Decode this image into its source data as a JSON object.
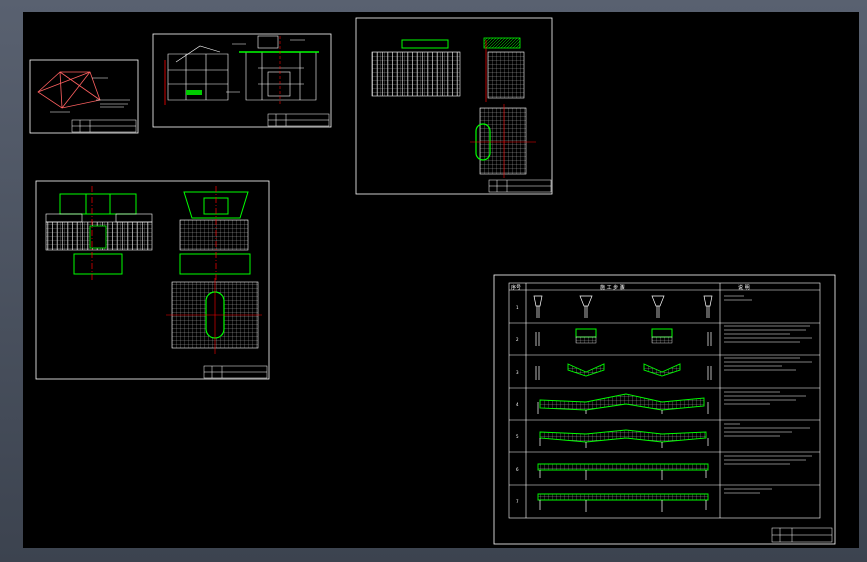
{
  "app": {
    "accent": "#00ff00",
    "line": "#ffffff",
    "axis": "#ff0000",
    "background": "#000000"
  },
  "construction_table": {
    "header": {
      "col_no": "序号",
      "col_steps": "施 工 步 骤",
      "col_notes": "说 明"
    },
    "rows": [
      "1",
      "2",
      "3",
      "4",
      "5",
      "6",
      "7"
    ]
  }
}
